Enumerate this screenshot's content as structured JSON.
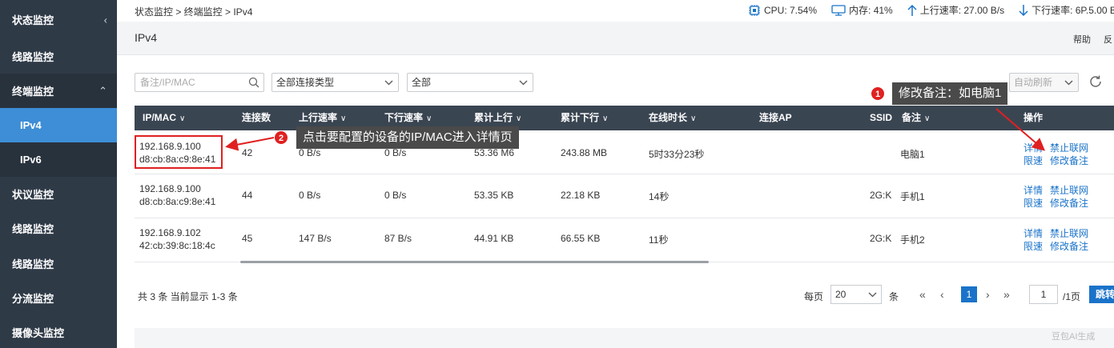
{
  "sidebar": {
    "items": [
      {
        "label": "状态监控",
        "chev": "‹"
      },
      {
        "label": "线路监控"
      },
      {
        "label": "终端监控",
        "chev": "⌃"
      },
      {
        "label": "IPv4"
      },
      {
        "label": "IPv6"
      },
      {
        "label": "状议监控"
      },
      {
        "label": "线路监控"
      },
      {
        "label": "线路监控"
      },
      {
        "label": "分流监控"
      },
      {
        "label": "摄像头监控"
      }
    ]
  },
  "topbar": {
    "breadcrumb": "状态监控 > 终端监控 > IPv4",
    "cpu": "CPU: 7.54%",
    "mem": "内存: 41%",
    "up": "上行速率: 27.00 B/s",
    "down": "下行速率: 6P.5.00 B"
  },
  "header": {
    "title": "IPv4",
    "help": "帮助",
    "back": "反"
  },
  "filters": {
    "search_placeholder": "备注/IP/MAC",
    "conn_type": "全部连接类型",
    "all": "全部",
    "auto_refresh": "自动刷新"
  },
  "table": {
    "columns": [
      "IP/MAC",
      "连接数",
      "上行速率",
      "下行速率",
      "累计上行",
      "累计下行",
      "在线时长",
      "连接AP",
      "SSID",
      "备注",
      "操作"
    ],
    "rows": [
      {
        "ip": "192.168.9.100",
        "mac": "d8:cb:8a:c9:8e:41",
        "conn": "42",
        "up": "0 B/s",
        "down": "0 B/s",
        "total_up": "53.36 M6",
        "total_down": "243.88 MB",
        "online": "5时33分23秒",
        "ap": "",
        "ssid": "",
        "note": "电脑1",
        "a1": "详情",
        "a2": "禁止联网",
        "a3": "限速",
        "a4": "修改备注"
      },
      {
        "ip": "192.168.9.100",
        "mac": "d8:cb:8a:c9:8e:41",
        "conn": "44",
        "up": "0 B/s",
        "down": "0 B/s",
        "total_up": "53.35 KB",
        "total_down": "22.18 KB",
        "online": "14秒",
        "ap": "",
        "ssid": "2G:K",
        "note": "手机1",
        "a1": "详情",
        "a2": "禁止联网",
        "a3": "限速",
        "a4": "修改备注"
      },
      {
        "ip": "192.168.9.102",
        "mac": "42:cb:39:8c:18:4c",
        "conn": "45",
        "up": "147 B/s",
        "down": "87 B/s",
        "total_up": "44.91 KB",
        "total_down": "66.55 KB",
        "online": "11秒",
        "ap": "",
        "ssid": "2G:K",
        "note": "手机2",
        "a1": "详情",
        "a2": "禁止联网",
        "a3": "限速",
        "a4": "修改备注"
      }
    ]
  },
  "pager": {
    "summary": "共 3 条 当前显示 1-3 条",
    "per_page_label": "每页",
    "per_page": "20",
    "unit": "条",
    "first": "«",
    "prev": "‹",
    "current": "1",
    "next": "›",
    "last": "»",
    "goto_value": "1",
    "total_pages": "/1页",
    "go": "跳转"
  },
  "annotations": {
    "callout1_num": "1",
    "callout1_text": "修改备注：如电脑1",
    "callout2_num": "2",
    "callout2_text": "点击要配置的设备的IP/MAC进入详情页"
  },
  "watermark": "豆包AI生成",
  "colors": {
    "sidebar": "#2f3a47",
    "active": "#3d8ed6",
    "link": "#1a73c9",
    "highlight": "#e02020"
  }
}
